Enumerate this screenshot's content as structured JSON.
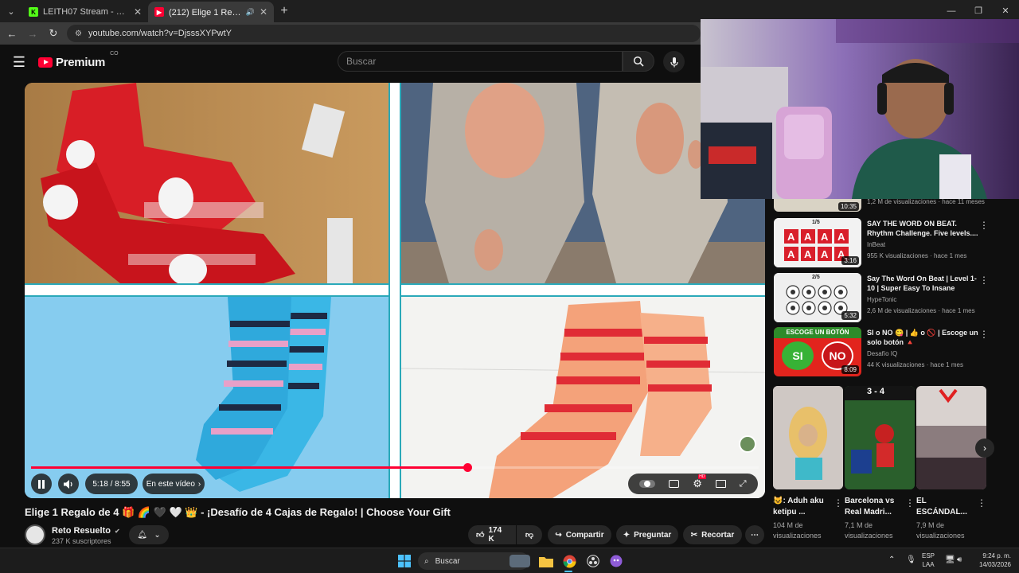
{
  "browser": {
    "tabs": [
      {
        "title": "LEITH07 Stream - Watch Live on",
        "favicon_color": "#53fc18",
        "favicon_letter": "K",
        "close": "✕"
      },
      {
        "title": "(212) Elige 1 Regalo de 4 🎁",
        "favicon_color": "#ff0033",
        "favicon_letter": "▶",
        "close": "✕"
      }
    ],
    "new_tab": "+",
    "url": "youtube.com/watch?v=DjsssXYPwtY",
    "window_controls": [
      "—",
      "❐",
      "✕"
    ]
  },
  "header": {
    "logo_text": "Premium",
    "country": "CO",
    "search_placeholder": "Buscar"
  },
  "player": {
    "progress": 0.6,
    "time": "5:18 / 8:55",
    "chapter": "En este vídeo",
    "hd_badge": "HD"
  },
  "video": {
    "title": "Elige 1 Regalo de 4 🎁 🌈 🖤 🤍 👑 - ¡Desafío de 4 Cajas de Regalo! | Choose Your Gift",
    "channel": "Reto Resuelto",
    "subscribers": "237 K suscriptores",
    "likes": "174 K",
    "share": "Compartir",
    "ask": "Preguntar",
    "clip": "Recortar"
  },
  "sidebar": {
    "partial_meta": "1,2 M de visualizaciones · hace 11 meses",
    "partial_duration": "10:35",
    "items": [
      {
        "title": "SAY THE WORD ON BEAT. Rhythm Challenge. Five levels....",
        "channel": "InBeat",
        "meta": "955 K visualizaciones · hace 1 mes",
        "duration": "3:16",
        "badge": "1/5"
      },
      {
        "title": "Say The Word On Beat | Level 1-10 | Super Easy To Insane",
        "channel": "HypeTonic",
        "meta": "2,6 M de visualizaciones · hace 1 mes",
        "duration": "5:32",
        "badge": "2/5"
      },
      {
        "title": "SI o NO 😋 | 👍 o 🚫 | Escoge un solo botón 🔺",
        "channel": "Desafío IQ",
        "meta": "44 K visualizaciones · hace 1 mes",
        "duration": "8:09",
        "banner": "ESCOGE UN BOTÓN",
        "yes": "SI",
        "no": "NO"
      }
    ],
    "shorts": [
      {
        "title": "😺: Aduh aku ketipu ...",
        "views": "104 M de visualizaciones"
      },
      {
        "title": "Barcelona vs Real Madri...",
        "views": "7,1 M de visualizaciones",
        "score": "3 - 4"
      },
      {
        "title": "EL ESCÁNDAL...",
        "views": "7,9 M de visualizaciones"
      }
    ]
  },
  "taskbar": {
    "search": "Buscar",
    "lang": "ESP",
    "lang2": "LAA",
    "time": "9:24 p. m.",
    "date": "14/03/2026"
  }
}
